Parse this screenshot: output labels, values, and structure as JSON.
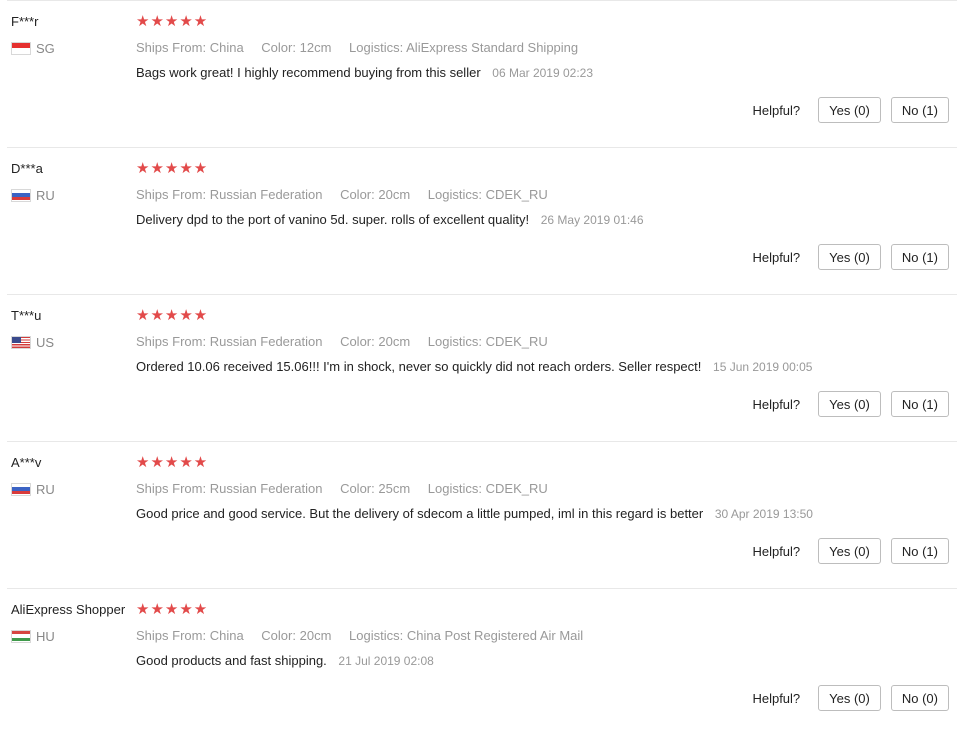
{
  "labels": {
    "ships_from": "Ships From:",
    "color": "Color:",
    "logistics": "Logistics:",
    "helpful": "Helpful?"
  },
  "stars_glyph": "★★★★★",
  "colors": {
    "star": "#e24a4a",
    "secondary_text": "#999999"
  },
  "reviews": [
    {
      "user": "F***r",
      "country": "SG",
      "flag": "singapore-flag",
      "rating": 5,
      "ships_from": "China",
      "color": "12cm",
      "logistics": "AliExpress Standard Shipping",
      "text": "Bags work great! I highly recommend buying from this seller",
      "date": "06 Mar 2019 02:23",
      "yes": "Yes (0)",
      "no": "No (1)"
    },
    {
      "user": "D***a",
      "country": "RU",
      "flag": "russia-flag",
      "rating": 5,
      "ships_from": "Russian Federation",
      "color": "20cm",
      "logistics": "CDEK_RU",
      "text": "Delivery dpd to the port of vanino 5d. super. rolls of excellent quality!",
      "date": "26 May 2019 01:46",
      "yes": "Yes (0)",
      "no": "No (1)"
    },
    {
      "user": "T***u",
      "country": "US",
      "flag": "usa-flag",
      "rating": 5,
      "ships_from": "Russian Federation",
      "color": "20cm",
      "logistics": "CDEK_RU",
      "text": "Ordered 10.06 received 15.06!!! I'm in shock, never so quickly did not reach orders. Seller respect!",
      "date": "15 Jun 2019 00:05",
      "yes": "Yes (0)",
      "no": "No (1)"
    },
    {
      "user": "A***v",
      "country": "RU",
      "flag": "russia-flag",
      "rating": 5,
      "ships_from": "Russian Federation",
      "color": "25cm",
      "logistics": "CDEK_RU",
      "text": "Good price and good service. But the delivery of sdecom a little pumped, iml in this regard is better",
      "date": "30 Apr 2019 13:50",
      "yes": "Yes (0)",
      "no": "No (1)"
    },
    {
      "user": "AliExpress Shopper",
      "country": "HU",
      "flag": "hungary-flag",
      "rating": 5,
      "ships_from": "China",
      "color": "20cm",
      "logistics": "China Post Registered Air Mail",
      "text": "Good products and fast shipping.",
      "date": "21 Jul 2019 02:08",
      "yes": "Yes (0)",
      "no": "No (0)"
    }
  ]
}
